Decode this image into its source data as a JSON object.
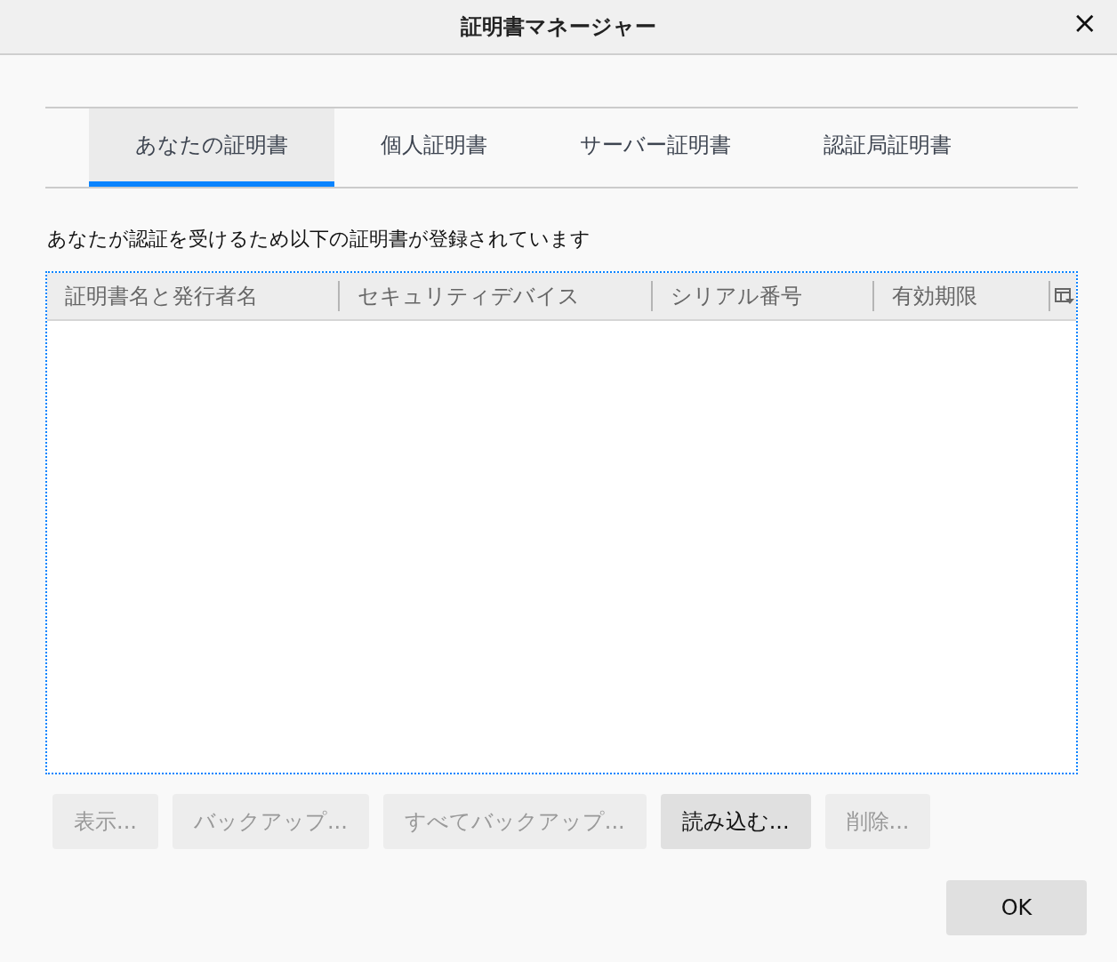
{
  "window": {
    "title": "証明書マネージャー",
    "close": "×"
  },
  "tabs": [
    {
      "label": "あなたの証明書",
      "selected": true
    },
    {
      "label": "個人証明書",
      "selected": false
    },
    {
      "label": "サーバー証明書",
      "selected": false
    },
    {
      "label": "認証局証明書",
      "selected": false
    }
  ],
  "description": "あなたが認証を受けるため以下の証明書が登録されています",
  "table": {
    "columns": [
      "証明書名と発行者名",
      "セキュリティデバイス",
      "シリアル番号",
      "有効期限"
    ]
  },
  "buttons": [
    {
      "label": "表示...",
      "disabled": true
    },
    {
      "label": "バックアップ...",
      "disabled": true
    },
    {
      "label": "すべてバックアップ...",
      "disabled": true
    },
    {
      "label": "読み込む...",
      "disabled": false
    },
    {
      "label": "削除...",
      "disabled": true
    }
  ],
  "ok_button": "OK"
}
